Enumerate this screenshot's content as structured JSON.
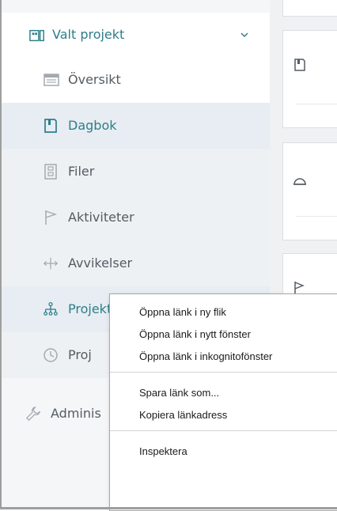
{
  "sidebar": {
    "selected_project": "Valt projekt",
    "items": [
      {
        "label": "Översikt",
        "icon": "overview-icon"
      },
      {
        "label": "Dagbok",
        "icon": "diary-icon"
      },
      {
        "label": "Filer",
        "icon": "files-icon"
      },
      {
        "label": "Aktiviteter",
        "icon": "flag-icon"
      },
      {
        "label": "Avvikelser",
        "icon": "deviation-icon"
      },
      {
        "label": "Projektorganisation",
        "icon": "org-chart-icon"
      },
      {
        "label": "Proj",
        "icon": "clock-icon"
      }
    ],
    "admin_label": "Adminis"
  },
  "context_menu": {
    "items": [
      "Öppna länk i ny flik",
      "Öppna länk i nytt fönster",
      "Öppna länk i inkognitofönster",
      "Spara länk som...",
      "Kopiera länkadress",
      "Inspektera"
    ]
  },
  "colors": {
    "accent": "#2e7e8a",
    "text_grey": "#545c63",
    "sidebar_bg": "#f5f6f8"
  }
}
